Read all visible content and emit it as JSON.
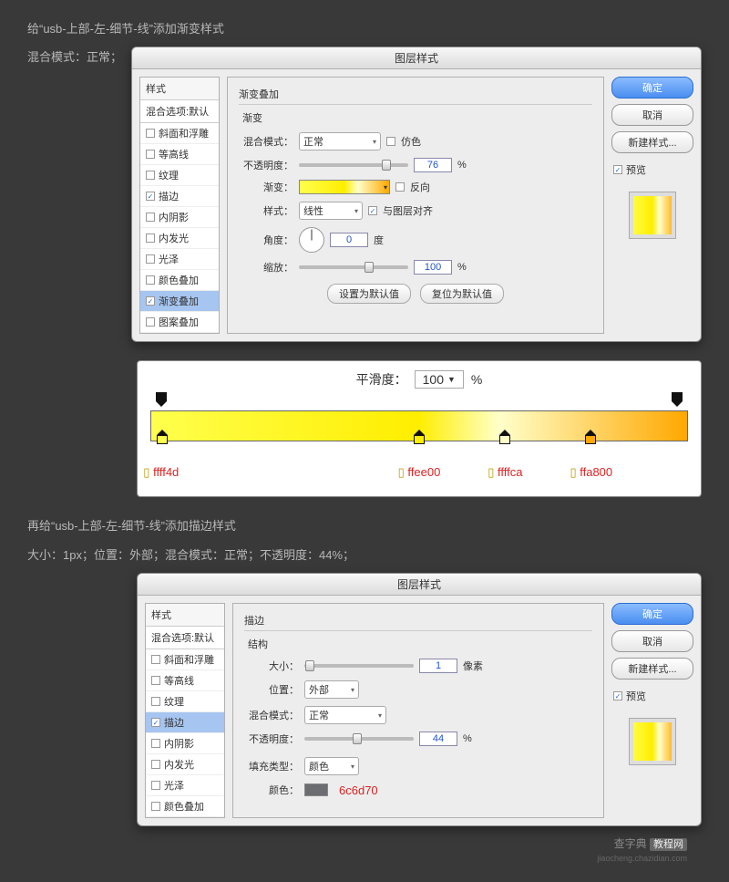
{
  "caption1_line1": "给“usb-上部-左-细节-线”添加渐变样式",
  "caption1_line2": "混合模式：正常；",
  "caption2_line1": "再给“usb-上部-左-细节-线”添加描边样式",
  "caption2_line2": "大小：1px；位置：外部；混合模式：正常；不透明度：44%；",
  "dialog1": {
    "title": "图层样式",
    "styles_header": "样式",
    "blend_options": "混合选项:默认",
    "items": [
      {
        "label": "斜面和浮雕",
        "checked": false
      },
      {
        "label": "等高线",
        "checked": false
      },
      {
        "label": "纹理",
        "checked": false
      },
      {
        "label": "描边",
        "checked": true
      },
      {
        "label": "内阴影",
        "checked": false
      },
      {
        "label": "内发光",
        "checked": false
      },
      {
        "label": "光泽",
        "checked": false
      },
      {
        "label": "颜色叠加",
        "checked": false
      },
      {
        "label": "渐变叠加",
        "checked": true,
        "selected": true
      },
      {
        "label": "图案叠加",
        "checked": false
      }
    ],
    "panel": {
      "title": "渐变叠加",
      "subtitle": "渐变",
      "blend_label": "混合模式：",
      "blend_value": "正常",
      "dither_label": "仿色",
      "opacity_label": "不透明度：",
      "opacity_value": "76",
      "percent": "%",
      "gradient_label": "渐变：",
      "reverse_label": "反向",
      "style_label": "样式：",
      "style_value": "线性",
      "align_label": "与图层对齐",
      "angle_label": "角度：",
      "angle_value": "0",
      "degree": "度",
      "scale_label": "缩放：",
      "scale_value": "100",
      "defaults_btn": "设置为默认值",
      "reset_btn": "复位为默认值"
    },
    "actions": {
      "ok": "确定",
      "cancel": "取消",
      "new": "新建样式...",
      "preview": "预览"
    }
  },
  "gradient_editor": {
    "smooth_label": "平滑度：",
    "smooth_value": "100",
    "percent": "%",
    "stops": [
      {
        "pos": 2,
        "hex": "ffff4d",
        "color": "#ffff4d"
      },
      {
        "pos": 50,
        "hex": "ffee00",
        "color": "#ffee00"
      },
      {
        "pos": 66,
        "hex": "ffffca",
        "color": "#ffffca"
      },
      {
        "pos": 82,
        "hex": "ffa800",
        "color": "#ffa800"
      }
    ]
  },
  "dialog2": {
    "title": "图层样式",
    "styles_header": "样式",
    "blend_options": "混合选项:默认",
    "items": [
      {
        "label": "斜面和浮雕",
        "checked": false
      },
      {
        "label": "等高线",
        "checked": false
      },
      {
        "label": "纹理",
        "checked": false
      },
      {
        "label": "描边",
        "checked": true,
        "selected": true
      },
      {
        "label": "内阴影",
        "checked": false
      },
      {
        "label": "内发光",
        "checked": false
      },
      {
        "label": "光泽",
        "checked": false
      },
      {
        "label": "颜色叠加",
        "checked": false
      }
    ],
    "panel": {
      "title": "描边",
      "subtitle": "结构",
      "size_label": "大小：",
      "size_value": "1",
      "px": "像素",
      "pos_label": "位置：",
      "pos_value": "外部",
      "blend_label": "混合模式：",
      "blend_value": "正常",
      "opacity_label": "不透明度：",
      "opacity_value": "44",
      "percent": "%",
      "fill_label": "填充类型：",
      "fill_value": "颜色",
      "color_label": "颜色：",
      "color_hex": "6c6d70",
      "color_chip": "#6c6d70"
    },
    "actions": {
      "ok": "确定",
      "cancel": "取消",
      "new": "新建样式...",
      "preview": "预览"
    }
  },
  "watermark": {
    "brand": "查字典",
    "tag": "教程网",
    "url": "jiaocheng.chazidian.com"
  }
}
